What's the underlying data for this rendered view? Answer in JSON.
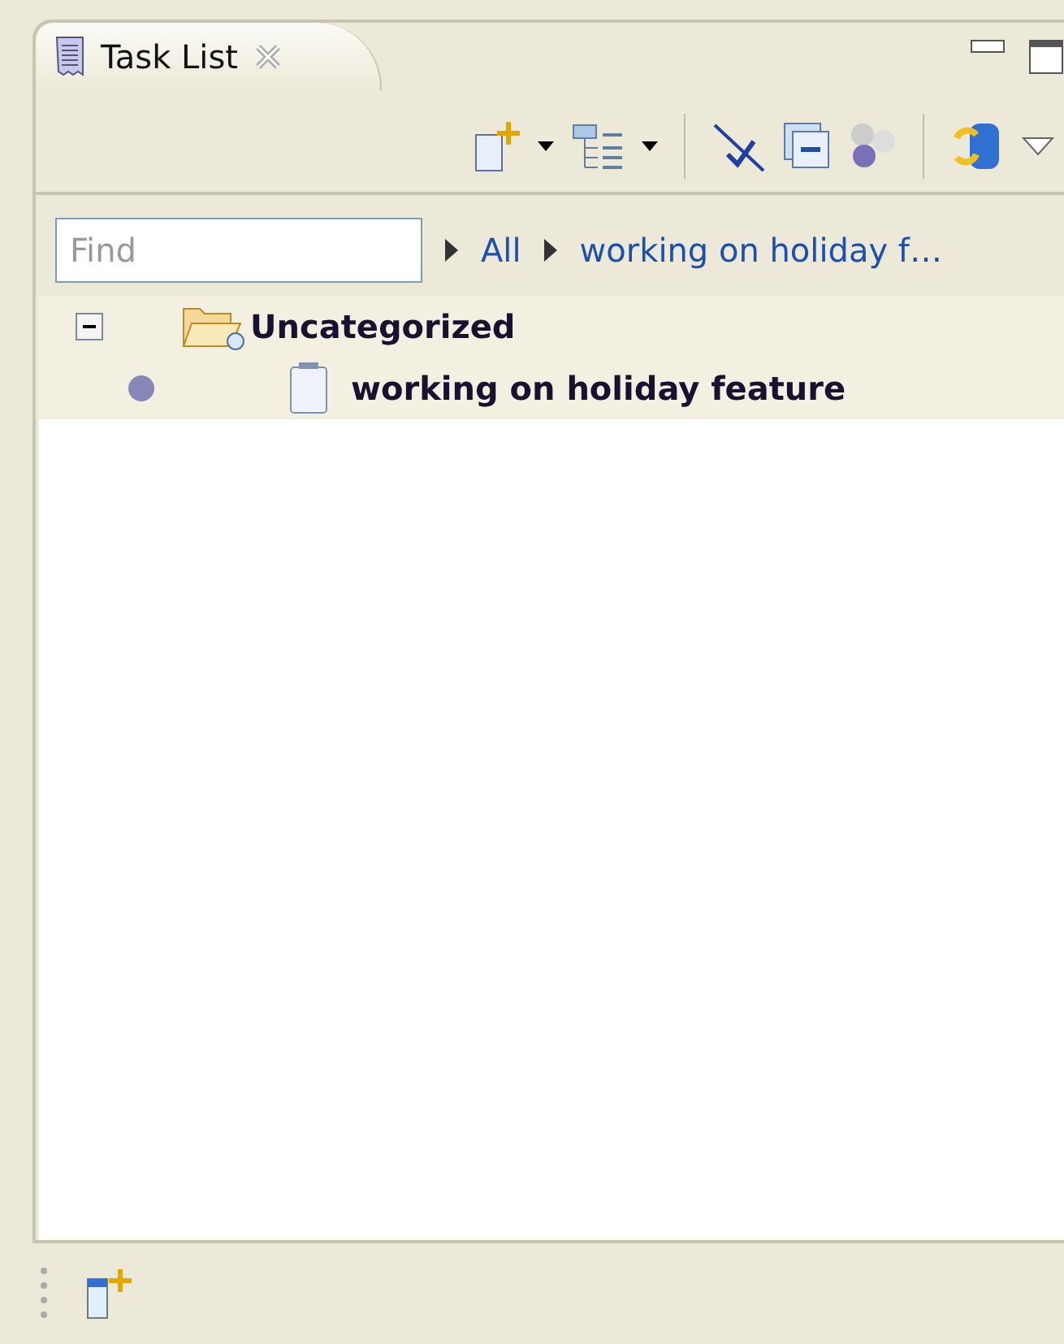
{
  "view": {
    "title": "Task List"
  },
  "find": {
    "placeholder": "Find"
  },
  "breadcrumbs": [
    {
      "label": "All"
    },
    {
      "label": "working on holiday f…"
    }
  ],
  "tree": [
    {
      "label": "Uncategorized",
      "kind": "category",
      "expanded": true,
      "children": [
        {
          "label": "working on holiday feature",
          "kind": "task"
        }
      ]
    }
  ]
}
